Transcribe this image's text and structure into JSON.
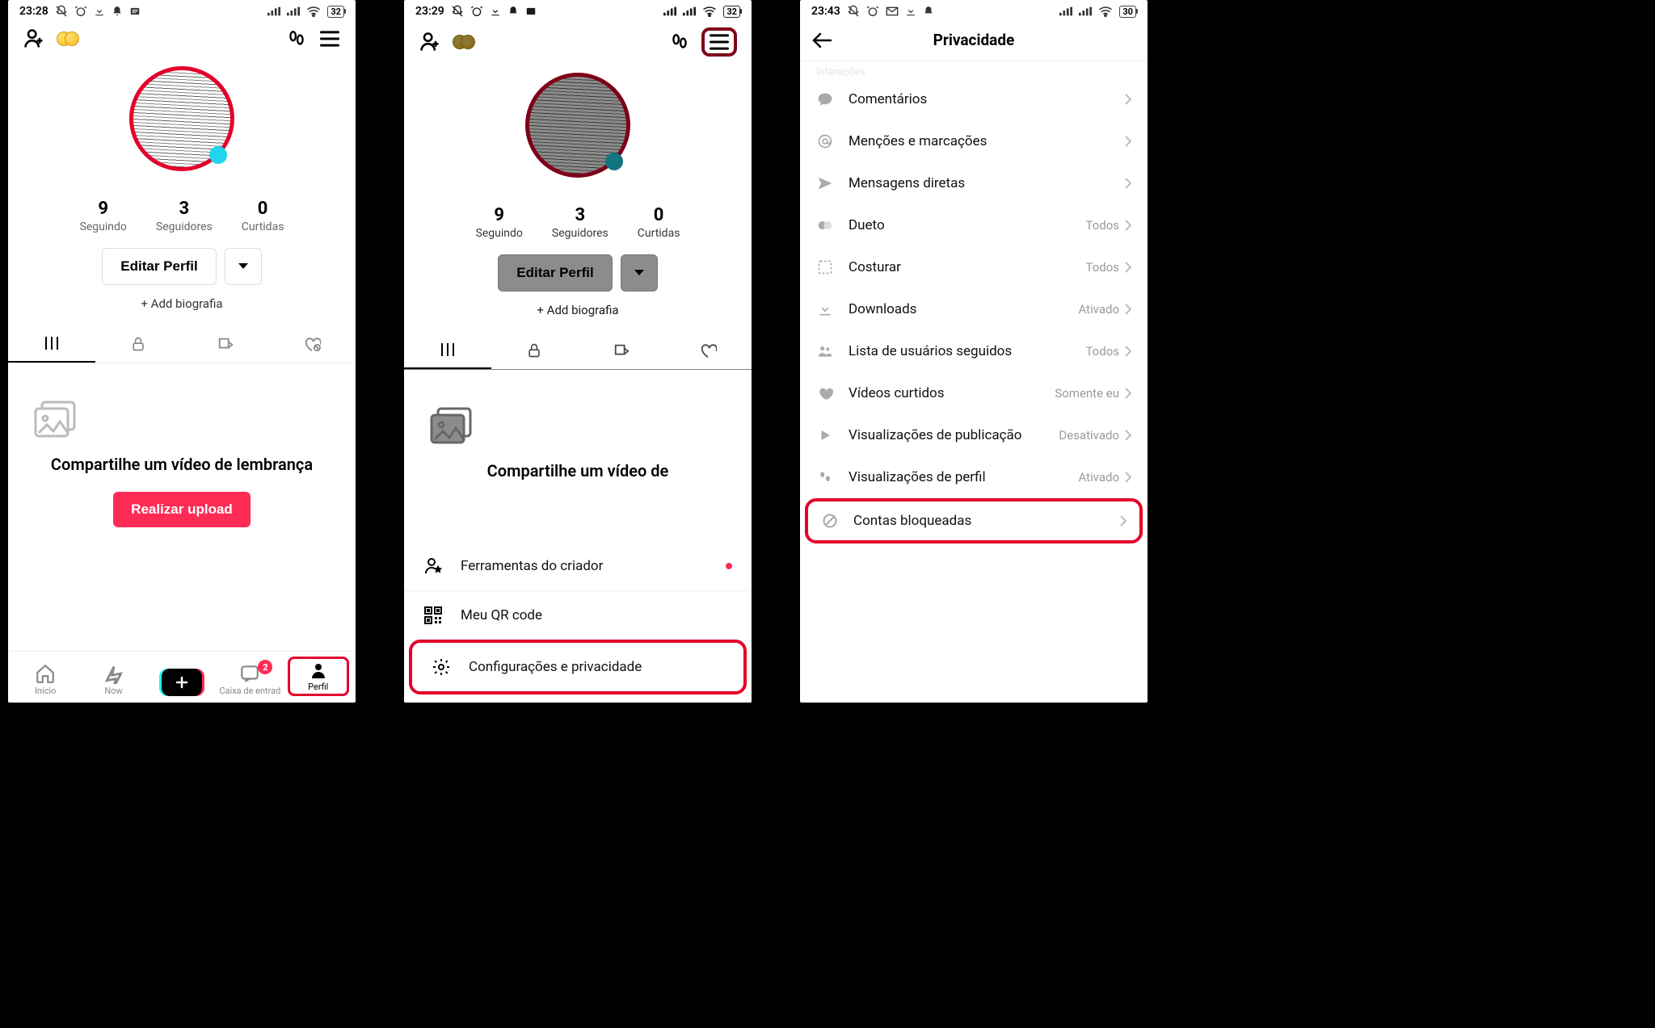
{
  "screen1": {
    "status_time": "23:28",
    "battery": "32",
    "stats": {
      "following_val": "9",
      "following_lbl": "Seguindo",
      "followers_val": "3",
      "followers_lbl": "Seguidores",
      "likes_val": "0",
      "likes_lbl": "Curtidas"
    },
    "edit_profile": "Editar Perfil",
    "add_bio": "+ Add biografia",
    "empty_title": "Compartilhe um vídeo de lembrança",
    "upload": "Realizar upload",
    "nav": {
      "home": "Início",
      "now": "Now",
      "inbox": "Caixa de entrad",
      "inbox_badge": "2",
      "profile": "Perfil"
    }
  },
  "screen2": {
    "status_time": "23:29",
    "battery": "32",
    "stats": {
      "following_val": "9",
      "following_lbl": "Seguindo",
      "followers_val": "3",
      "followers_lbl": "Seguidores",
      "likes_val": "0",
      "likes_lbl": "Curtidas"
    },
    "edit_profile": "Editar Perfil",
    "add_bio": "+ Add biografia",
    "empty_title": "Compartilhe um vídeo de",
    "sheet": {
      "creator_tools": "Ferramentas do criador",
      "qr": "Meu QR code",
      "settings": "Configurações e privacidade"
    }
  },
  "screen3": {
    "status_time": "23:43",
    "battery": "30",
    "title": "Privacidade",
    "section": "Interações",
    "rows": {
      "comments": "Comentários",
      "mentions": "Menções e marcações",
      "dm": "Mensagens diretas",
      "duet": "Dueto",
      "duet_val": "Todos",
      "stitch": "Costurar",
      "stitch_val": "Todos",
      "downloads": "Downloads",
      "downloads_val": "Ativado",
      "following_list": "Lista de usuários seguidos",
      "following_list_val": "Todos",
      "liked": "Vídeos curtidos",
      "liked_val": "Somente eu",
      "post_views": "Visualizações de publicação",
      "post_views_val": "Desativado",
      "profile_views": "Visualizações de perfil",
      "profile_views_val": "Ativado",
      "blocked": "Contas bloqueadas"
    }
  }
}
